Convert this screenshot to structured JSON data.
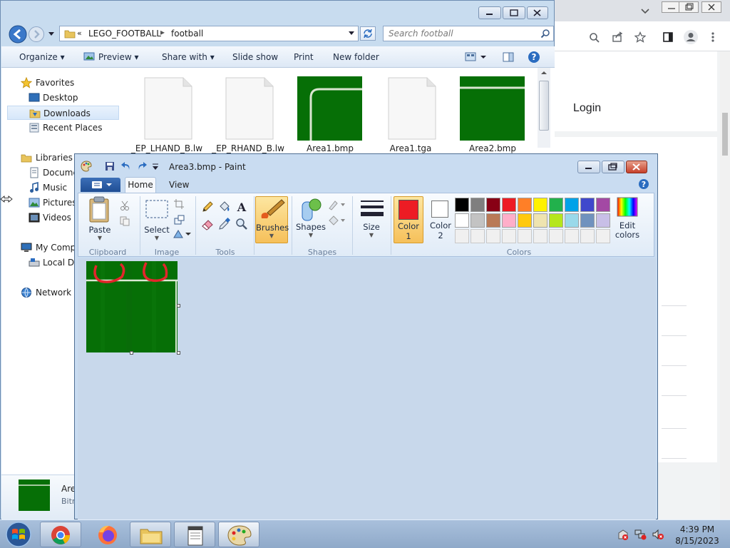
{
  "explorer": {
    "breadcrumb": {
      "chevron": "«",
      "parts": [
        "LEGO_FOOTBALL",
        "football"
      ]
    },
    "search_placeholder": "Search football",
    "commands": [
      "Organize",
      "Preview",
      "Share with",
      "Slide show",
      "Print",
      "New folder"
    ],
    "nav": {
      "favorites": "Favorites",
      "desktop": "Desktop",
      "downloads": "Downloads",
      "recent_places": "Recent Places",
      "libraries": "Libraries",
      "documents": "Docume",
      "music": "Music",
      "pictures": "Pictures",
      "videos": "Videos",
      "my_computer": "My Compu",
      "local_disk": "Local Dis",
      "network": "Network"
    },
    "files": [
      {
        "name": "_EP_LHAND_B.lw",
        "type": "doc"
      },
      {
        "name": "_EP_RHAND_B.lw",
        "type": "doc"
      },
      {
        "name": "Area1.bmp",
        "type": "field-corner"
      },
      {
        "name": "Area1.tga",
        "type": "doc"
      },
      {
        "name": "Area2.bmp",
        "type": "field-edge"
      }
    ],
    "details": {
      "name": "Are",
      "type": "Bitr"
    }
  },
  "chrome": {
    "login": "Login"
  },
  "paint": {
    "title": "Area3.bmp - Paint",
    "tabs": {
      "home": "Home",
      "view": "View"
    },
    "ribbon": {
      "paste": "Paste",
      "select": "Select",
      "brushes": "Brushes",
      "shapes": "Shapes",
      "size": "Size",
      "color1": "Color",
      "color1_num": "1",
      "color2": "Color",
      "color2_num": "2",
      "edit_colors": "Edit",
      "edit_colors2": "colors",
      "groups": {
        "clipboard": "Clipboard",
        "image": "Image",
        "tools": "Tools",
        "shapes": "Shapes",
        "colors": "Colors"
      }
    },
    "palette_row1": [
      "#000000",
      "#7f7f7f",
      "#880015",
      "#ed1c24",
      "#ff7f27",
      "#fff200",
      "#22b14c",
      "#00a2e8",
      "#3f48cc",
      "#a349a4"
    ],
    "palette_row2": [
      "#ffffff",
      "#c3c3c3",
      "#b97a57",
      "#ffaec9",
      "#ffc90e",
      "#efe4b0",
      "#b5e61d",
      "#99d9ea",
      "#7092be",
      "#c8bfe7"
    ],
    "color1_value": "#ed1c24",
    "color2_value": "#ffffff"
  },
  "taskbar": {
    "time": "4:39 PM",
    "date": "8/15/2023"
  }
}
